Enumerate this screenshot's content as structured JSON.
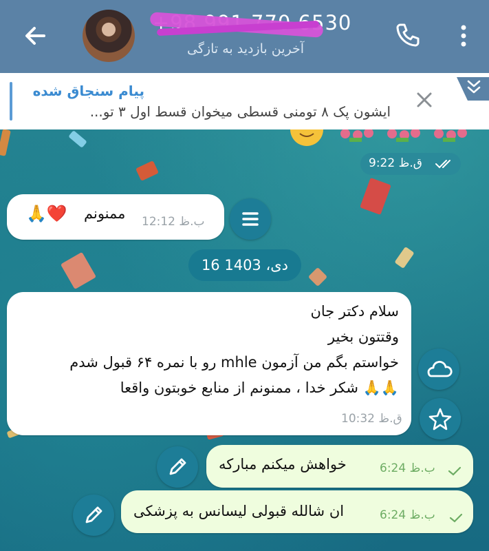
{
  "header": {
    "title": "+98 991 770 6530",
    "status": "آخرین بازدید به تازگی"
  },
  "pinned": {
    "title": "پیام سنجاق شده",
    "text": "ایشون پک ۸ تومنی قسطی میخوان قسط اول ۳ تو..."
  },
  "messages": {
    "prev_time": "9:22 ق.ظ",
    "m1": {
      "text": "ممنونم",
      "emoji": "🙏❤️",
      "time": "12:12 ب.ظ"
    },
    "date": "16 دی، 1403",
    "m2": {
      "lines": [
        "سلام دکتر جان",
        "وقتتون بخیر",
        "خواستم بگم من آزمون mhle رو با نمره ۶۴ قبول شدم",
        "شکر خدا ، ممنونم از منابع خوبتون واقعا"
      ],
      "emoji": "🙏🙏",
      "time": "10:32 ق.ظ"
    },
    "m3": {
      "text": "خواهش میکنم مبارکه",
      "time": "6:24 ب.ظ"
    },
    "m4": {
      "text": "ان شالله قبولی لیسانس به پزشکی",
      "time": "6:24 ب.ظ"
    }
  },
  "colors": {
    "header": "#5b82a6",
    "accent": "#3b8bd1",
    "outgoing_bubble": "#effdde",
    "chat_bg": "#1d6f86"
  },
  "icons": {
    "back": "arrow-left-icon",
    "call": "phone-icon",
    "menu": "more-vertical-icon",
    "close": "close-icon",
    "expand": "chevron-double-down-icon",
    "menu_lines": "list-icon",
    "cloud": "cloud-icon",
    "star": "star-icon",
    "edit": "pencil-icon",
    "read": "double-check-icon",
    "sent": "check-icon"
  }
}
